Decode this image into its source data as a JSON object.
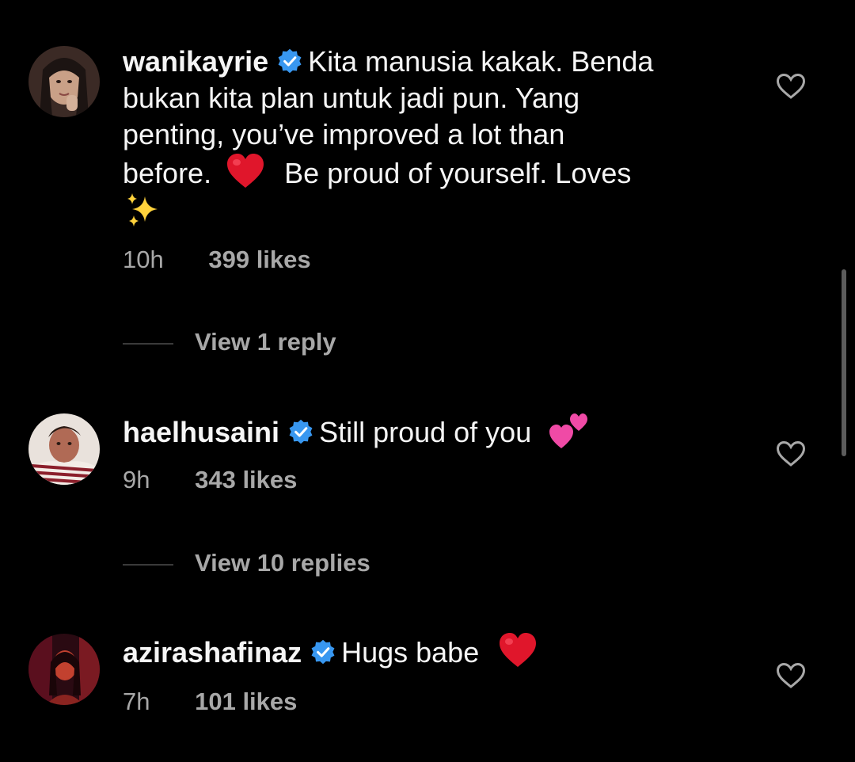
{
  "comments": [
    {
      "username": "wanikayrie",
      "line1": "Kita manusia kakak. Benda",
      "line2": "bukan kita plan untuk jadi pun. Yang",
      "line3": "penting, you’ve improved a lot than",
      "line4_a": "before.",
      "line4_emoji": "red-heart-emoji",
      "line4_b": "Be proud of yourself. Loves",
      "line5_emoji": "sparkles-emoji",
      "time": "10h",
      "likes": "399 likes",
      "replies": "View 1 reply",
      "avatar_colors": [
        "#3b2a25",
        "#c9a087",
        "#1c1412"
      ]
    },
    {
      "username": "haelhusaini",
      "text": "Still proud of you",
      "emoji": "two-hearts-emoji",
      "time": "9h",
      "likes": "343 likes",
      "replies": "View 10 replies",
      "avatar_colors": [
        "#e9e2dc",
        "#b06a55",
        "#8b1f2b"
      ]
    },
    {
      "username": "azirashafinaz",
      "text": "Hugs babe",
      "emoji": "red-heart-emoji",
      "time": "7h",
      "likes": "101 likes",
      "avatar_colors": [
        "#5a0f1e",
        "#c2412f",
        "#2a0a12"
      ]
    }
  ],
  "colors": {
    "background": "#000000",
    "primary_text": "#f5f5f5",
    "secondary_text": "#a8a8a8",
    "verified_badge": "#3897f0",
    "heart_emoji": "#e0162b",
    "pink_hearts": "#f04aa6"
  },
  "icons": {
    "verified": "verified-badge-icon",
    "like": "heart-outline-icon"
  }
}
